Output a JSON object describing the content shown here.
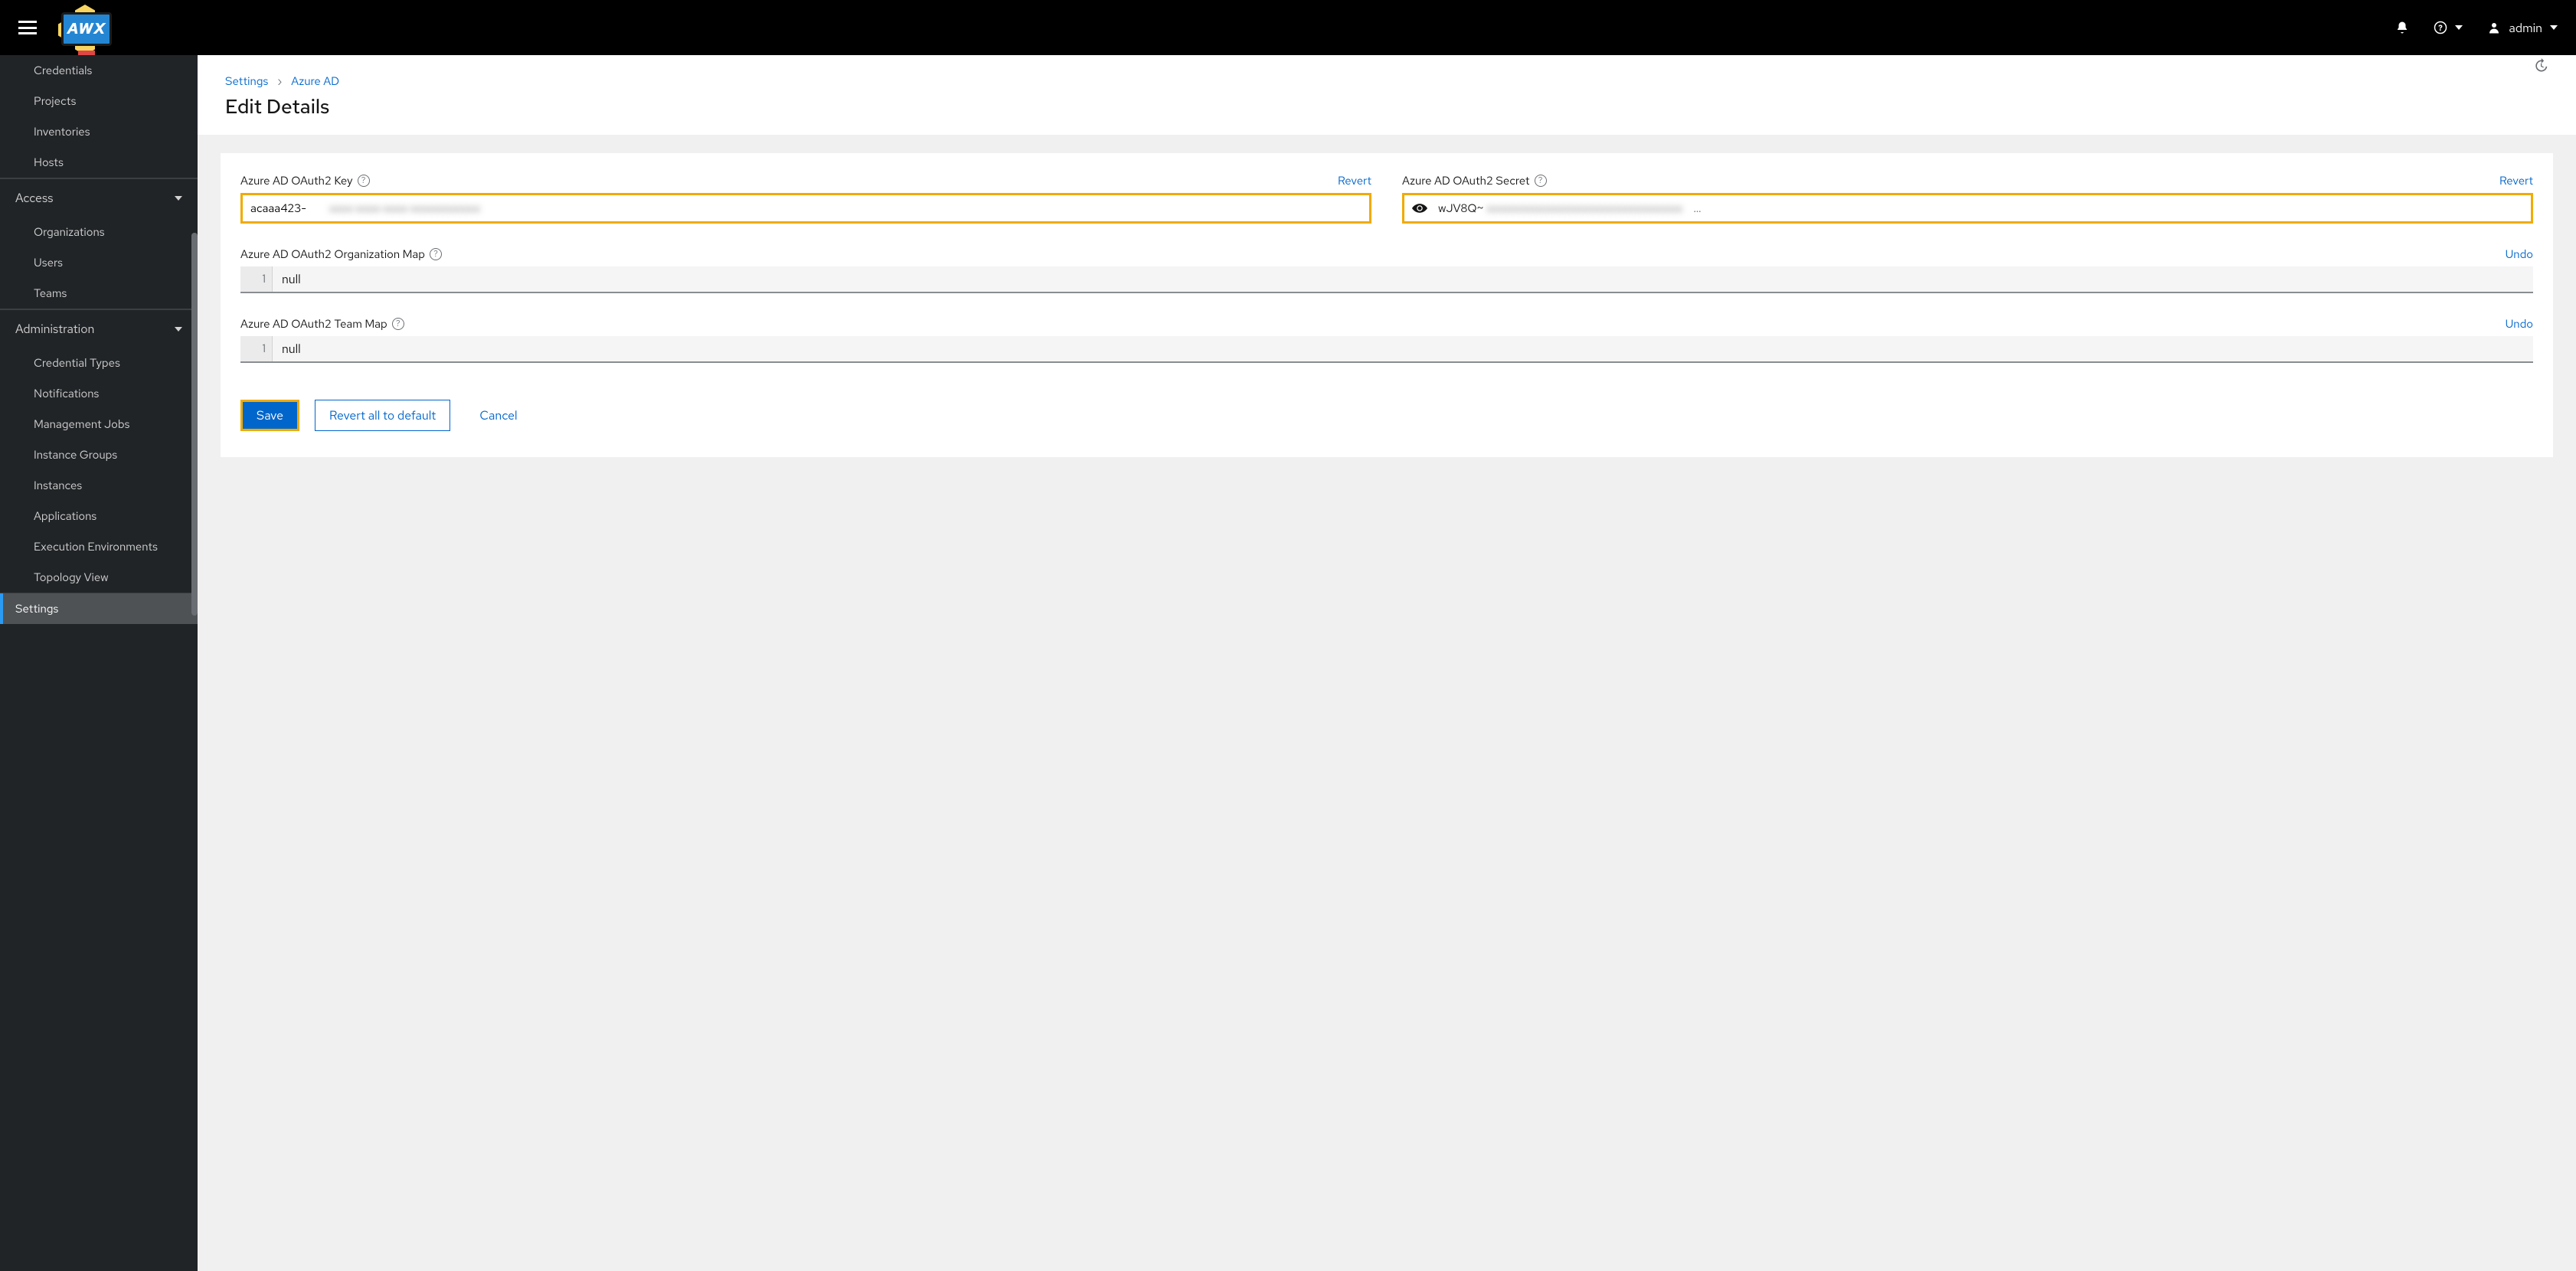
{
  "header": {
    "logo_text": "AWX",
    "user_label": "admin"
  },
  "sidebar": {
    "top_items": [
      "Credentials",
      "Projects",
      "Inventories",
      "Hosts"
    ],
    "group_access": {
      "label": "Access",
      "items": [
        "Organizations",
        "Users",
        "Teams"
      ]
    },
    "group_admin": {
      "label": "Administration",
      "items": [
        "Credential Types",
        "Notifications",
        "Management Jobs",
        "Instance Groups",
        "Instances",
        "Applications",
        "Execution Environments",
        "Topology View"
      ]
    },
    "settings_label": "Settings"
  },
  "breadcrumb": {
    "root": "Settings",
    "leaf": "Azure AD"
  },
  "page_title": "Edit Details",
  "form": {
    "key": {
      "label": "Azure AD OAuth2 Key",
      "action": "Revert",
      "value": "acaaa423-"
    },
    "secret": {
      "label": "Azure AD OAuth2 Secret",
      "action": "Revert",
      "value": "wJV8Q~",
      "ellipsis": "…"
    },
    "org_map": {
      "label": "Azure AD OAuth2 Organization Map",
      "action": "Undo",
      "line_no": "1",
      "content": "null"
    },
    "team_map": {
      "label": "Azure AD OAuth2 Team Map",
      "action": "Undo",
      "line_no": "1",
      "content": "null"
    }
  },
  "buttons": {
    "save": "Save",
    "revert_all": "Revert all to default",
    "cancel": "Cancel"
  }
}
